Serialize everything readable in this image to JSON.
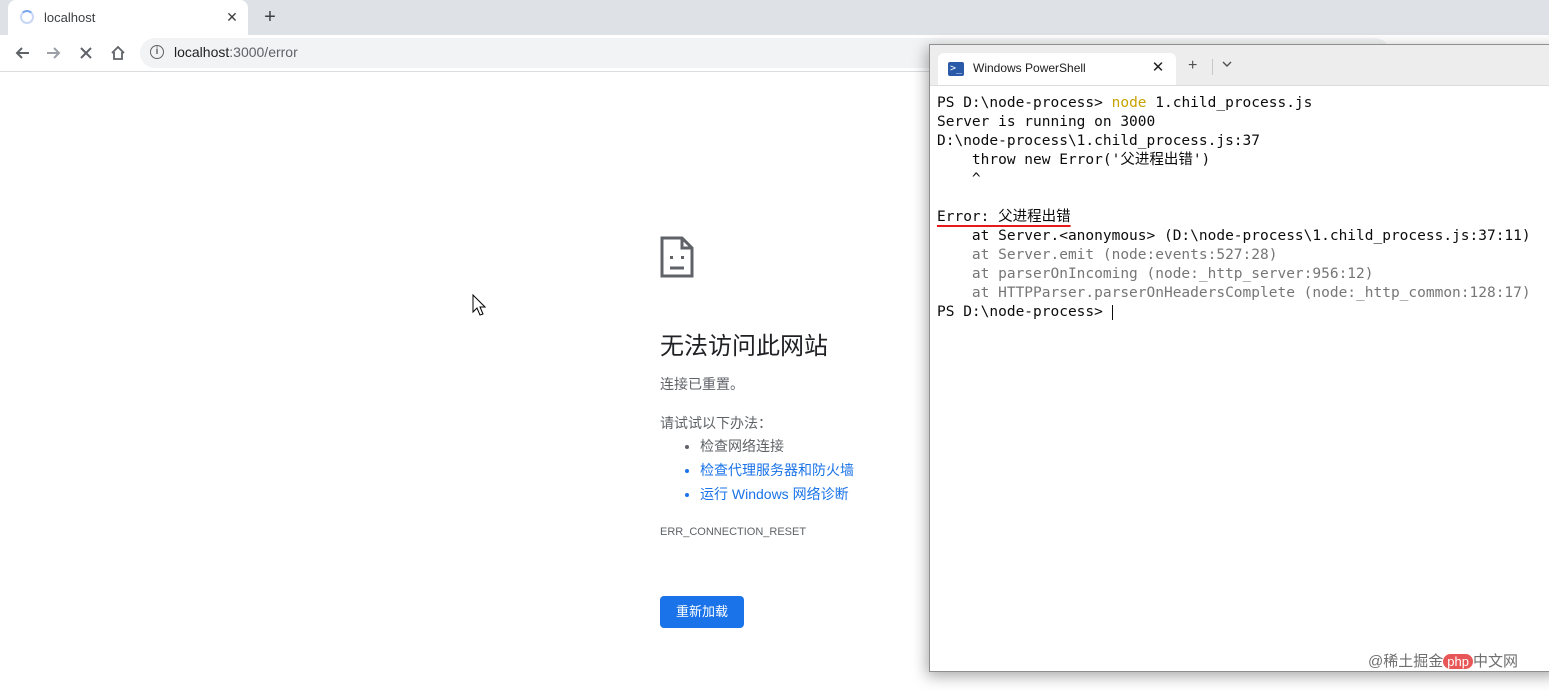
{
  "browser": {
    "tab_title": "localhost",
    "tab_close": "✕",
    "new_tab": "+",
    "url_host": "localhost",
    "url_path": ":3000/error"
  },
  "error_page": {
    "title": "无法访问此网站",
    "subtitle": "连接已重置。",
    "try_label": "请试试以下办法：",
    "suggestions": [
      "检查网络连接",
      "检查代理服务器和防火墙",
      "运行 Windows 网络诊断"
    ],
    "error_code": "ERR_CONNECTION_RESET",
    "reload_label": "重新加载"
  },
  "powershell": {
    "tab_title": "Windows PowerShell",
    "tab_close": "✕",
    "new_tab": "+",
    "dropdown": "⌄",
    "prompt": "PS D:\\node-process> ",
    "cmd_keyword": "node",
    "cmd_arg": " 1.child_process.js",
    "lines": [
      "Server is running on 3000",
      "D:\\node-process\\1.child_process.js:37",
      "    throw new Error('父进程出错')",
      "    ^"
    ],
    "error_line": "Error: 父进程出错",
    "stack": [
      "    at Server.<anonymous> (D:\\node-process\\1.child_process.js:37:11)",
      "    at Server.emit (node:events:527:28)",
      "    at parserOnIncoming (node:_http_server:956:12)",
      "    at HTTPParser.parserOnHeadersComplete (node:_http_common:128:17)"
    ],
    "final_prompt": "PS D:\\node-process> "
  },
  "watermark": {
    "prefix": "@稀土掘金",
    "badge": "php",
    "suffix": "中文网"
  }
}
